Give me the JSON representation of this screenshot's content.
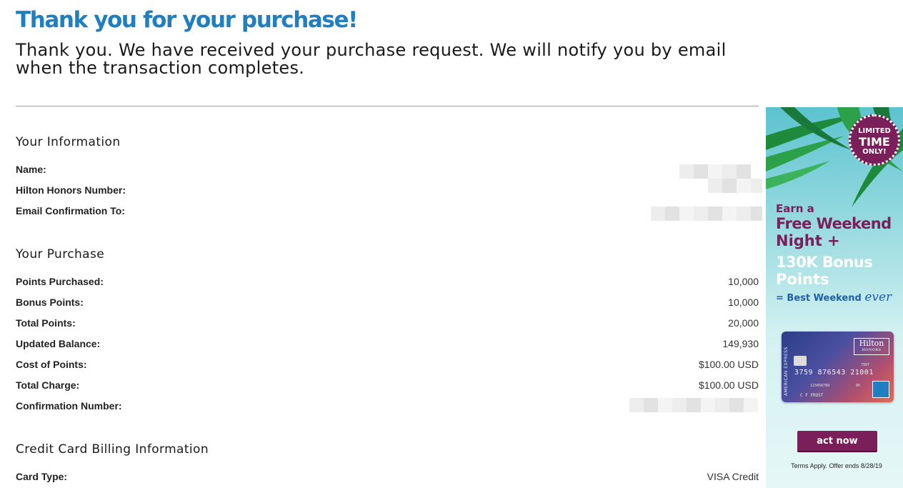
{
  "header": {
    "title": "Thank you for your purchase!",
    "subtitle": "Thank you. We have received your purchase request. We will notify you by email when the transaction completes."
  },
  "your_information": {
    "section_title": "Your Information",
    "rows": [
      {
        "label": "Name:"
      },
      {
        "label": "Hilton Honors Number:"
      },
      {
        "label": "Email Confirmation To:"
      }
    ]
  },
  "your_purchase": {
    "section_title": "Your Purchase",
    "rows": [
      {
        "label": "Points Purchased:",
        "value": "10,000"
      },
      {
        "label": "Bonus Points:",
        "value": "10,000"
      },
      {
        "label": "Total Points:",
        "value": "20,000"
      },
      {
        "label": "Updated Balance:",
        "value": "149,930"
      },
      {
        "label": "Cost of Points:",
        "value": "$100.00 USD"
      },
      {
        "label": "Total Charge:",
        "value": "$100.00 USD"
      },
      {
        "label": "Confirmation Number:"
      }
    ]
  },
  "billing": {
    "section_title": "Credit Card Billing Information",
    "rows": [
      {
        "label": "Card Type:",
        "value": "VISA Credit"
      }
    ]
  },
  "ad": {
    "badge_line1": "LIMITED",
    "badge_line2": "TIME",
    "badge_line3": "ONLY!",
    "line1": "Earn a",
    "line2": "Free Weekend",
    "line3": "Night +",
    "line4": "130K Bonus",
    "line5": "Points",
    "line6": "= Best Weekend",
    "line6_script": "ever",
    "card_side_text": "AMERICAN EXPRESS",
    "card_brand": "Hilton",
    "card_brand_sub": "HONORS",
    "card_number": "3759 876543 21001",
    "card_name": "C F FROST",
    "card_small1": "123456789",
    "card_small2": "95",
    "card_small3": "7997",
    "button_label": "act now",
    "terms": "Terms Apply. Offer ends 8/28/19",
    "colors": {
      "purple": "#7a1f5a",
      "blue": "#1f5fa8",
      "title_blue": "#1f7fc0"
    }
  }
}
